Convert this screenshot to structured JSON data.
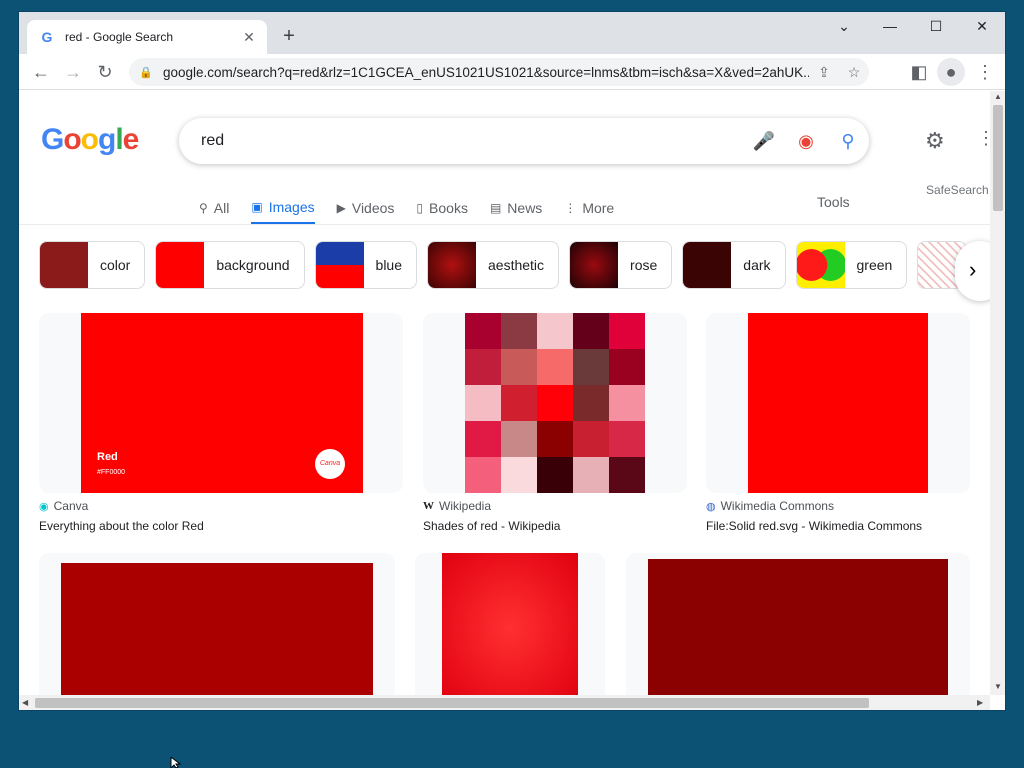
{
  "browser": {
    "tab_title": "red - Google Search",
    "url": "google.com/search?q=red&rlz=1C1GCEA_enUS1021US1021&source=lnms&tbm=isch&sa=X&ved=2ahUK..."
  },
  "search": {
    "query": "red",
    "safesearch": "SafeSearch",
    "tools": "Tools",
    "tabs": [
      {
        "label": "All",
        "icon": "search-icon"
      },
      {
        "label": "Images",
        "icon": "image-icon"
      },
      {
        "label": "Videos",
        "icon": "video-icon"
      },
      {
        "label": "Books",
        "icon": "book-icon"
      },
      {
        "label": "News",
        "icon": "news-icon"
      },
      {
        "label": "More",
        "icon": "more-vert-icon"
      }
    ]
  },
  "chips": [
    {
      "label": "color",
      "swatch": "#8b1a1a"
    },
    {
      "label": "background",
      "swatch": "#ff0000"
    },
    {
      "label": "blue",
      "swatch": "#1a3da8"
    },
    {
      "label": "aesthetic",
      "swatch": "#6b0a0a"
    },
    {
      "label": "rose",
      "swatch": "#4a0508"
    },
    {
      "label": "dark",
      "swatch": "#3a0404"
    },
    {
      "label": "green",
      "swatch": "#ff1a1a"
    }
  ],
  "results": [
    {
      "source": "Canva",
      "caption": "Everything about the color Red",
      "overlay_title": "Red",
      "overlay_hex": "#FF0000",
      "badge": "Canva"
    },
    {
      "source": "Wikipedia",
      "caption": "Shades of red - Wikipedia"
    },
    {
      "source": "Wikimedia Commons",
      "caption": "File:Solid red.svg - Wikimedia Commons"
    }
  ],
  "colors": {
    "accent": "#1a73e8",
    "red": "#ff0000"
  }
}
